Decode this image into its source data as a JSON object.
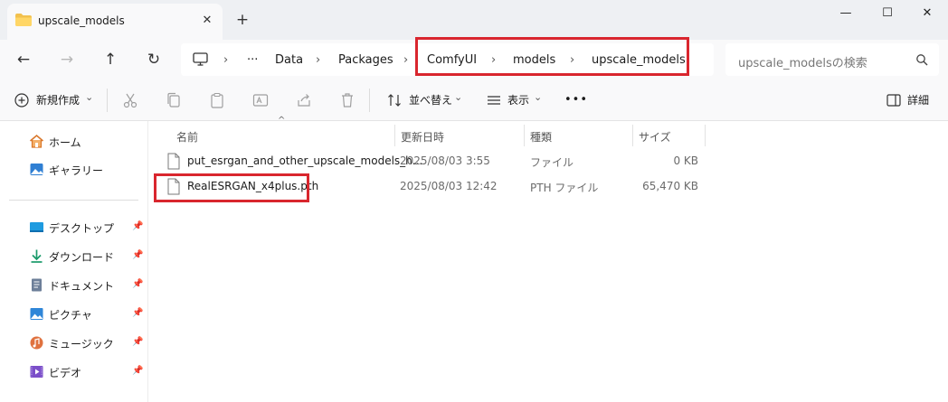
{
  "tab": {
    "title": "upscale_models",
    "close_glyph": "✕",
    "new_tab_glyph": "+"
  },
  "window": {
    "minimize": "—",
    "maximize": "☐",
    "close": "✕"
  },
  "nav": {
    "back": "←",
    "forward": "→",
    "up": "↑",
    "refresh": "↻"
  },
  "address": {
    "more": "···",
    "sep": "›",
    "crumbs": [
      "Data",
      "Packages",
      "ComfyUI",
      "models",
      "upscale_models"
    ]
  },
  "search": {
    "placeholder": "upscale_modelsの検索"
  },
  "commands": {
    "new": "新規作成",
    "sort": "並べ替え",
    "view": "表示",
    "more": "•••",
    "details": "詳細",
    "chevron": "⌄"
  },
  "sidebar": {
    "pin": "📌",
    "top_items": [
      {
        "label": "ホーム",
        "icon": "home-icon"
      },
      {
        "label": "ギャラリー",
        "icon": "gallery-icon"
      }
    ],
    "pinned_items": [
      {
        "label": "デスクトップ",
        "icon": "desktop-icon"
      },
      {
        "label": "ダウンロード",
        "icon": "download-icon"
      },
      {
        "label": "ドキュメント",
        "icon": "document-icon"
      },
      {
        "label": "ピクチャ",
        "icon": "picture-icon"
      },
      {
        "label": "ミュージック",
        "icon": "music-icon"
      },
      {
        "label": "ビデオ",
        "icon": "video-icon"
      }
    ]
  },
  "filelist": {
    "sort_caret": "^",
    "columns": {
      "name": "名前",
      "date": "更新日時",
      "type": "種類",
      "size": "サイズ"
    },
    "rows": [
      {
        "name": "put_esrgan_and_other_upscale_models_h...",
        "date": "2025/08/03 3:55",
        "type": "ファイル",
        "size": "0 KB"
      },
      {
        "name": "RealESRGAN_x4plus.pth",
        "date": "2025/08/03 12:42",
        "type": "PTH ファイル",
        "size": "65,470 KB"
      }
    ]
  },
  "colors": {
    "highlight": "#d9262e",
    "accent": "#0067c0"
  }
}
